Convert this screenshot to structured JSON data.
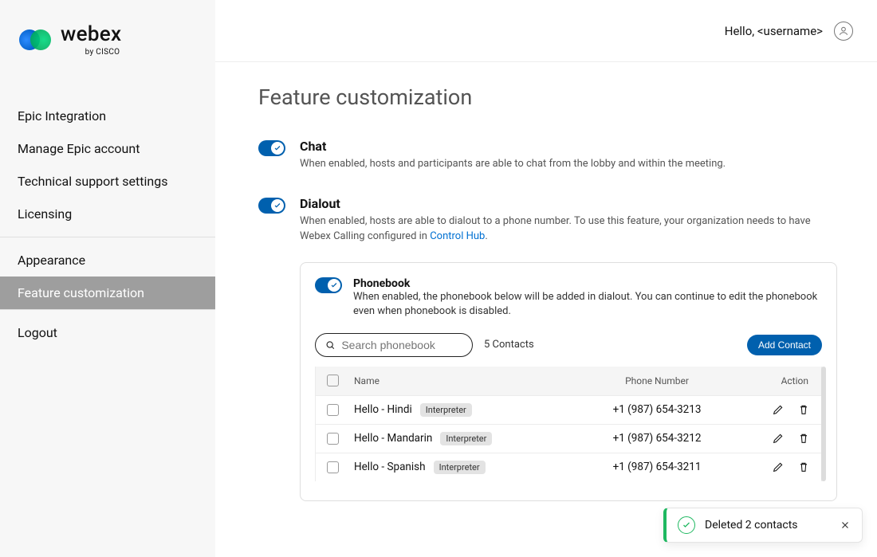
{
  "brand": {
    "name": "webex",
    "byline": "by CISCO"
  },
  "topbar": {
    "greeting": "Hello, <username>"
  },
  "sidebar": {
    "items": [
      {
        "label": "Epic Integration"
      },
      {
        "label": "Manage Epic account"
      },
      {
        "label": "Technical support settings"
      },
      {
        "label": "Licensing"
      }
    ],
    "items2": [
      {
        "label": "Appearance"
      },
      {
        "label": "Feature customization"
      }
    ],
    "items3": [
      {
        "label": "Logout"
      }
    ]
  },
  "page": {
    "title": "Feature customization"
  },
  "features": {
    "chat": {
      "title": "Chat",
      "desc": "When enabled, hosts and participants are able to chat from the lobby and within the meeting.",
      "enabled": true
    },
    "dialout": {
      "title": "Dialout",
      "desc_prefix": "When enabled, hosts are able to dialout to a phone number. To use this feature, your organization needs to have Webex Calling configured in ",
      "desc_link": "Control Hub",
      "desc_suffix": ".",
      "enabled": true
    },
    "phonebook": {
      "title": "Phonebook",
      "desc": "When enabled, the phonebook below will be added in dialout. You can continue to edit the phonebook even when phonebook is disabled.",
      "enabled": true,
      "search_placeholder": "Search phonebook",
      "count_label": "5 Contacts",
      "add_button": "Add Contact",
      "columns": {
        "name": "Name",
        "phone": "Phone Number",
        "action": "Action"
      },
      "tag_label": "Interpreter",
      "rows": [
        {
          "name": "Hello - Hindi",
          "phone": "+1 (987) 654-3213"
        },
        {
          "name": "Hello - Mandarin",
          "phone": "+1 (987) 654-3212"
        },
        {
          "name": "Hello - Spanish",
          "phone": "+1 (987) 654-3211"
        }
      ]
    }
  },
  "toast": {
    "message": "Deleted 2 contacts"
  }
}
